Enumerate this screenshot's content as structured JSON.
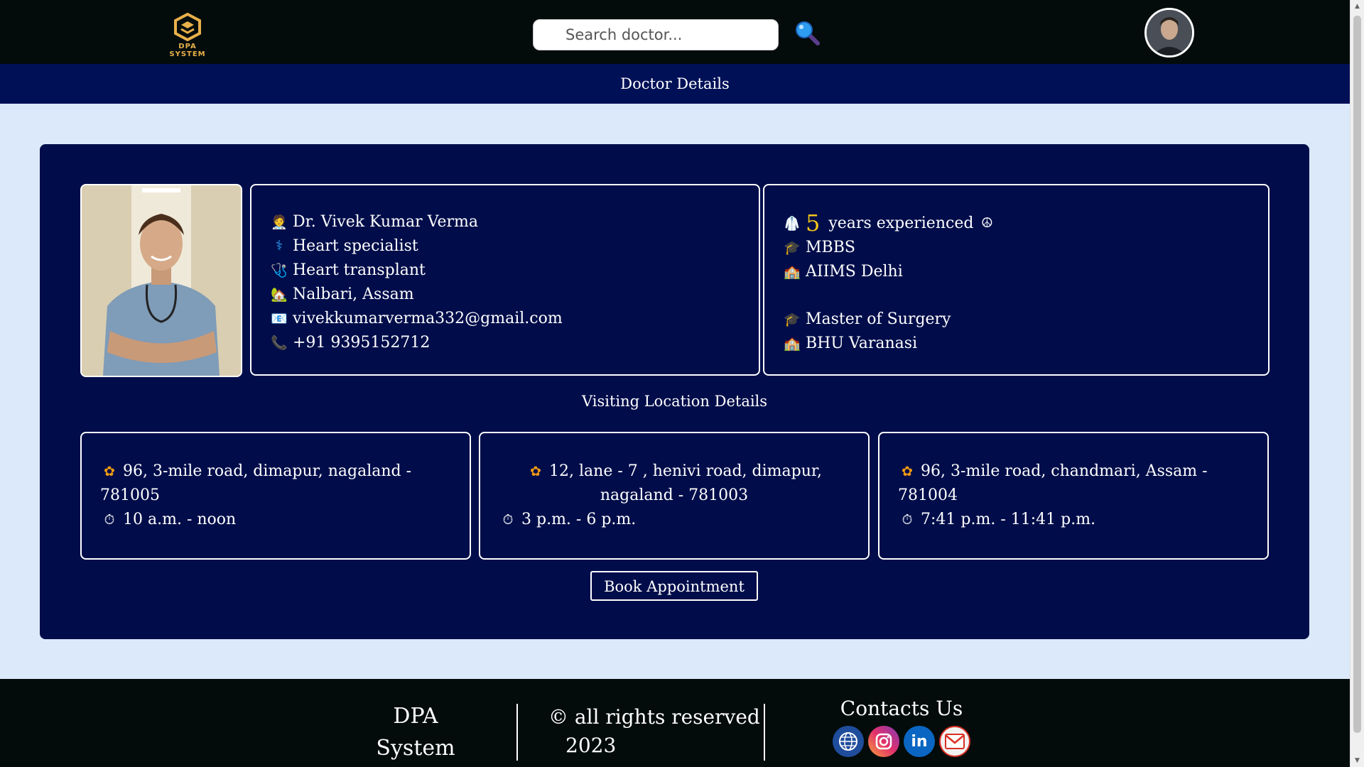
{
  "header": {
    "logo_text": "DPA SYSTEM",
    "search_placeholder": "Search doctor...",
    "search_icon": "magnifier-icon",
    "avatar": "user-avatar"
  },
  "subheader": {
    "title": "Doctor Details"
  },
  "doctor": {
    "name": "Dr. Vivek Kumar Verma",
    "specialty": "Heart specialist",
    "expertise": "Heart transplant",
    "location": "Nalbari, Assam",
    "email": "vivekkumarverma332@gmail.com",
    "phone": "+91 9395152712"
  },
  "experience": {
    "years": "5",
    "label": "years experienced",
    "degrees": [
      {
        "degree": "MBBS",
        "institute": "AIIMS Delhi"
      },
      {
        "degree": "Master of Surgery",
        "institute": "BHU Varanasi"
      }
    ]
  },
  "visiting": {
    "title": "Visiting Location Details",
    "locations": [
      {
        "address": "96, 3-mile road, dimapur, nagaland - 781005",
        "time": "10 a.m. - noon"
      },
      {
        "address": "12, lane - 7 , henivi road, dimapur, nagaland - 781003",
        "time": "3 p.m. - 6 p.m."
      },
      {
        "address": "96, 3-mile road, chandmari, Assam - 781004",
        "time": "7:41 p.m. - 11:41 p.m."
      }
    ]
  },
  "book_button": "Book Appointment",
  "footer": {
    "brand_line1": "DPA",
    "brand_line2": "System",
    "rights_line1": "© all rights reserved",
    "rights_line2": "2023",
    "contact_title": "Contacts Us",
    "socials": [
      "globe-icon",
      "instagram-icon",
      "linkedin-icon",
      "gmail-icon"
    ]
  },
  "colors": {
    "topbar": "#030c0b",
    "subbar": "#001057",
    "card": "#000d4a",
    "page_bg": "#dbe9fb",
    "accent": "#f5c518"
  }
}
